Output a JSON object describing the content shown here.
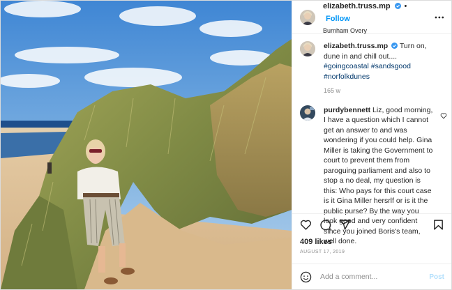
{
  "header": {
    "username": "elizabeth.truss.mp",
    "verified_icon": "verified-badge-icon",
    "follow_label": "Follow",
    "location": "Burnham Overy",
    "more_icon": "more-options-icon"
  },
  "caption": {
    "username": "elizabeth.truss.mp",
    "text": "Turn on, dune in and chill out....",
    "hashtags": [
      "#goingcoastal",
      "#sandsgood",
      "#norfolkdunes"
    ],
    "time": "165 w"
  },
  "comment": {
    "username": "purdybennett",
    "text": "Liz, good morning, I have a question which I cannot get an answer to and was wondering if you could help. Gina Miller is taking the Government to court to prevent them from paroguing parliament and also to stop a no deal, my question is this: Who pays for this court case is it Gina Miller hersrlf or is it the public purse? By the way you look good and very confident since you joined Boris's team, well done.",
    "like_icon": "heart-icon"
  },
  "actions": {
    "icons": [
      "heart-icon",
      "comment-icon",
      "share-icon",
      "bookmark-icon"
    ]
  },
  "likes": "409 likes",
  "date": "AUGUST 17, 2019",
  "add_comment": {
    "placeholder": "Add a comment...",
    "post_label": "Post",
    "emoji_icon": "emoji-icon"
  },
  "colors": {
    "accent": "#0095f6",
    "verified": "#3897f0",
    "post_disabled": "#b2dffc",
    "meta_gray": "#8e8e8e"
  }
}
